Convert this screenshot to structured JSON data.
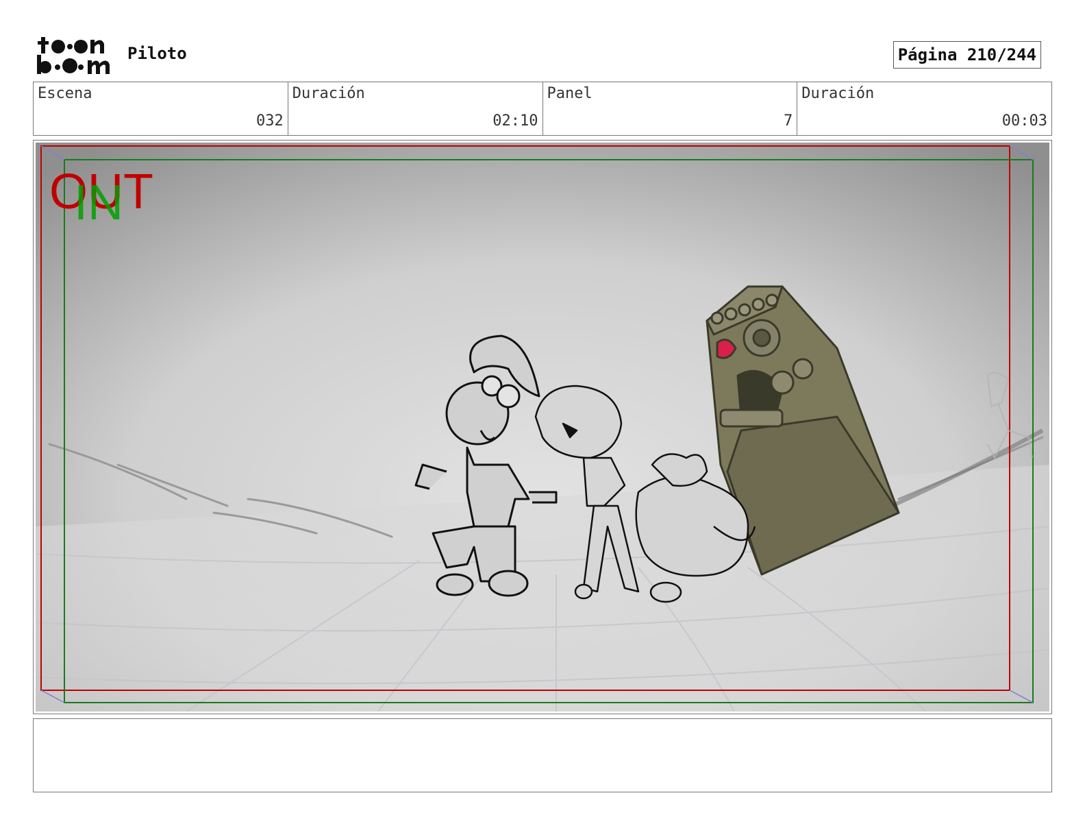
{
  "header": {
    "logo_alt": "toon boom",
    "project_title": "Piloto",
    "page_label": "Página 210/244"
  },
  "info": {
    "scene_label": "Escena",
    "scene_value": "032",
    "scene_duration_label": "Duración",
    "scene_duration_value": "02:10",
    "panel_label": "Panel",
    "panel_value": "7",
    "panel_duration_label": "Duración",
    "panel_duration_value": "00:03"
  },
  "panel": {
    "out_label": "OUT",
    "in_label": "IN",
    "out_color": "#c00000",
    "in_color": "#00a000"
  },
  "notes": {
    "text": ""
  }
}
